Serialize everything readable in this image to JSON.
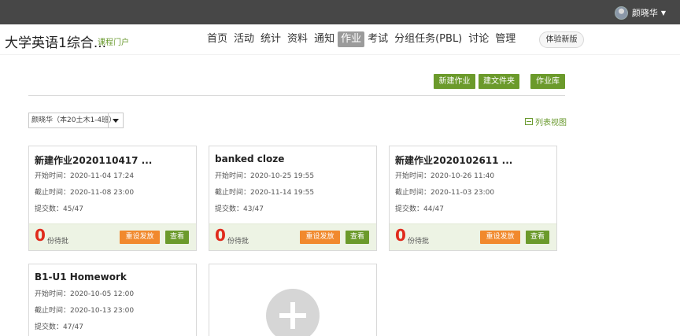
{
  "topbar": {
    "user_name": "颜晓华"
  },
  "header": {
    "course_title": "大学英语1综合...",
    "portal_link": "课程门户",
    "nav": [
      "首页",
      "活动",
      "统计",
      "资料",
      "通知",
      "作业",
      "考试",
      "分组任务(PBL)",
      "讨论",
      "管理"
    ],
    "active_nav": "作业",
    "try_new_label": "体验新版"
  },
  "actions": {
    "new_homework": "新建作业",
    "new_folder": "建文件夹",
    "homework_library": "作业库"
  },
  "class_select": {
    "value": "颜晓华（本20土木1-4班）"
  },
  "list_view_label": "列表视图",
  "card_labels": {
    "start": "开始时间：",
    "end": "截止时间：",
    "submit": "提交数：",
    "pending_label": "份待批",
    "reset_btn": "重设发放",
    "view_btn": "查看"
  },
  "cards": [
    {
      "title": "新建作业2020110417 ...",
      "start": "开始时间：2020-11-04 17:24",
      "end": "截止时间：2020-11-08 23:00",
      "submit": "提交数：45/47",
      "pending": "0"
    },
    {
      "title": "banked cloze",
      "start": "开始时间：2020-10-25 19:55",
      "end": "截止时间：2020-11-14 19:55",
      "submit": "提交数：43/47",
      "pending": "0"
    },
    {
      "title": "新建作业2020102611 ...",
      "start": "开始时间：2020-10-26 11:40",
      "end": "截止时间：2020-11-03 23:00",
      "submit": "提交数：44/47",
      "pending": "0"
    },
    {
      "title": "B1-U1 Homework",
      "start": "开始时间：2020-10-05 12:00",
      "end": "截止时间：2020-10-13 23:00",
      "submit": "提交数：47/47",
      "pending": ""
    }
  ],
  "colors": {
    "topbar": "#474747",
    "accent_green": "#6b9a2b",
    "orange": "#f1892d",
    "pending_red": "#e02b1d"
  }
}
